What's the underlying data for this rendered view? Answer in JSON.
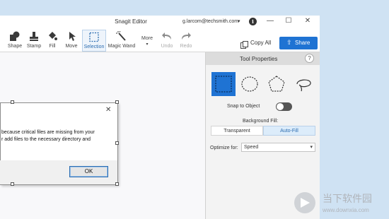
{
  "app": {
    "title": "Snagit Editor",
    "account": "g.larcom@techsmith.com",
    "account_caret": "▾",
    "info_symbol": "i",
    "window_buttons": {
      "minimize": "—",
      "maximize": "☐",
      "close": "✕"
    }
  },
  "toolbar": {
    "tools": [
      {
        "id": "shape",
        "label": "Shape",
        "icon": "shape-icon"
      },
      {
        "id": "stamp",
        "label": "Stamp",
        "icon": "stamp-icon"
      },
      {
        "id": "fill",
        "label": "Fill",
        "icon": "fill-icon"
      },
      {
        "id": "move",
        "label": "Move",
        "icon": "move-icon"
      },
      {
        "id": "selection",
        "label": "Selection",
        "icon": "selection-icon",
        "active": true
      },
      {
        "id": "magic-wand",
        "label": "Magic Wand",
        "icon": "magic-wand-icon"
      },
      {
        "id": "more",
        "label": "More",
        "icon": "chevron-down-icon"
      },
      {
        "id": "undo",
        "label": "Undo",
        "icon": "undo-icon",
        "disabled": true
      },
      {
        "id": "redo",
        "label": "Redo",
        "icon": "redo-icon",
        "disabled": true
      }
    ],
    "copy_all_label": "Copy All",
    "share_label": "Share"
  },
  "tool_properties": {
    "title": "Tool Properties",
    "help_symbol": "?",
    "shapes": [
      "rectangle-selection",
      "ellipse-selection",
      "polygon-selection",
      "freehand-selection"
    ],
    "selected_shape": "rectangle-selection",
    "snap_to_object_label": "Snap to Object",
    "snap_to_object_on": false,
    "background_fill_label": "Background Fill:",
    "background_fill_options": [
      "Transparent",
      "Auto-Fill"
    ],
    "background_fill_selected": "Auto-Fill",
    "optimize_label": "Optimize for:",
    "optimize_value": "Speed",
    "optimize_caret": "▾"
  },
  "dialog": {
    "close_symbol": "✕",
    "lines": [
      "because critical files are missing from your",
      "r add files to the necessary directory and"
    ],
    "ok_label": "OK"
  },
  "watermark": {
    "text_cn": "当下软件园",
    "url": "www.downxia.com"
  },
  "colors": {
    "accent": "#1f73d3",
    "desktop": "#cfe2f3",
    "panel_header": "#dcdcdc"
  }
}
